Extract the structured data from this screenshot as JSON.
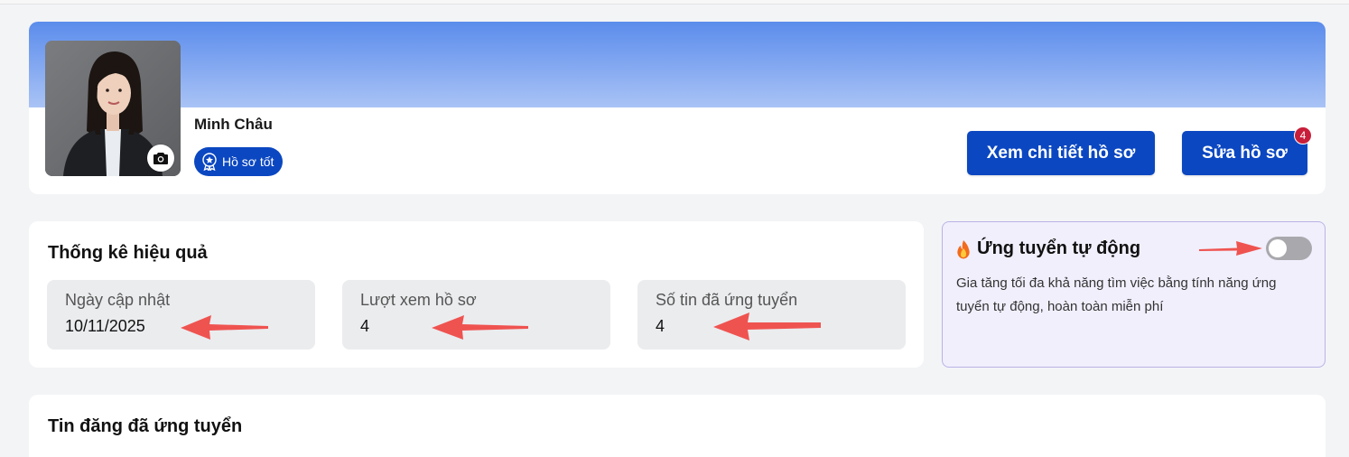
{
  "profile": {
    "name": "Minh Châu",
    "badge_label": "Hồ sơ tốt",
    "view_button": "Xem chi tiết hồ sơ",
    "edit_button": "Sửa hồ sơ",
    "notification_count": "4"
  },
  "stats": {
    "title": "Thống kê hiệu quả",
    "items": [
      {
        "label": "Ngày cập nhật",
        "value": "10/11/2025"
      },
      {
        "label": "Lượt xem hồ sơ",
        "value": "4"
      },
      {
        "label": "Số tin đã ứng tuyển",
        "value": "4"
      }
    ]
  },
  "auto_apply": {
    "icon": "fire-icon",
    "title": "Ứng tuyển tự động",
    "description": "Gia tăng tối đa khả năng tìm việc bằng tính năng ứng tuyển tự động, hoàn toàn miễn phí",
    "enabled": false
  },
  "applied": {
    "title": "Tin đăng đã ứng tuyển"
  },
  "colors": {
    "primary": "#0b47c1",
    "annotation_arrow": "#ef5350",
    "notification": "#c81e3a"
  }
}
